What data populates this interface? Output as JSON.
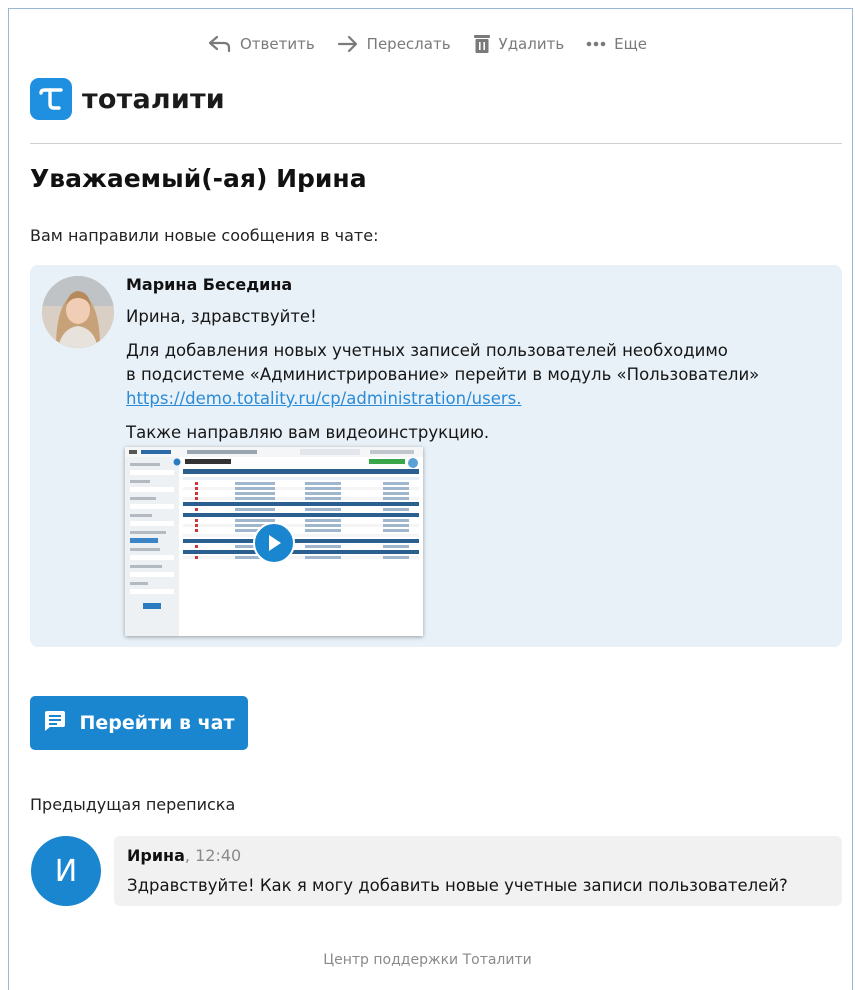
{
  "toolbar": {
    "reply_label": "Ответить",
    "forward_label": "Переслать",
    "delete_label": "Удалить",
    "more_label": "Еще"
  },
  "brand": {
    "name": "тоталити",
    "color": "#1f8fe0"
  },
  "greeting": "Уважаемый(-ая) Ирина",
  "intro": "Вам направили новые сообщения в чате:",
  "message": {
    "sender": "Марина Беседина",
    "greeting_line": "Ирина, здравствуйте!",
    "body_line1": "Для добавления новых учетных записей пользователей необходимо",
    "body_line2": "в подсистеме «Администрирование» перейти в модуль «Пользователи»",
    "link": "https://demo.totality.ru/cp/administration/users.",
    "video_note": "Также направляю вам видеоинструкцию."
  },
  "video": {
    "page_title": "Пользователи (38)",
    "accent": "#2b5f8f",
    "add_button_color": "#3aa64a"
  },
  "chat_button": {
    "label": "Перейти в чат",
    "color": "#1a86d0"
  },
  "previous": {
    "title": "Предыдущая переписка",
    "avatar_initial": "И",
    "author": "Ирина",
    "time": ", 12:40",
    "text": "Здравствуйте! Как я могу добавить новые учетные записи пользователей?"
  },
  "footer": "Центр поддержки Тоталити"
}
